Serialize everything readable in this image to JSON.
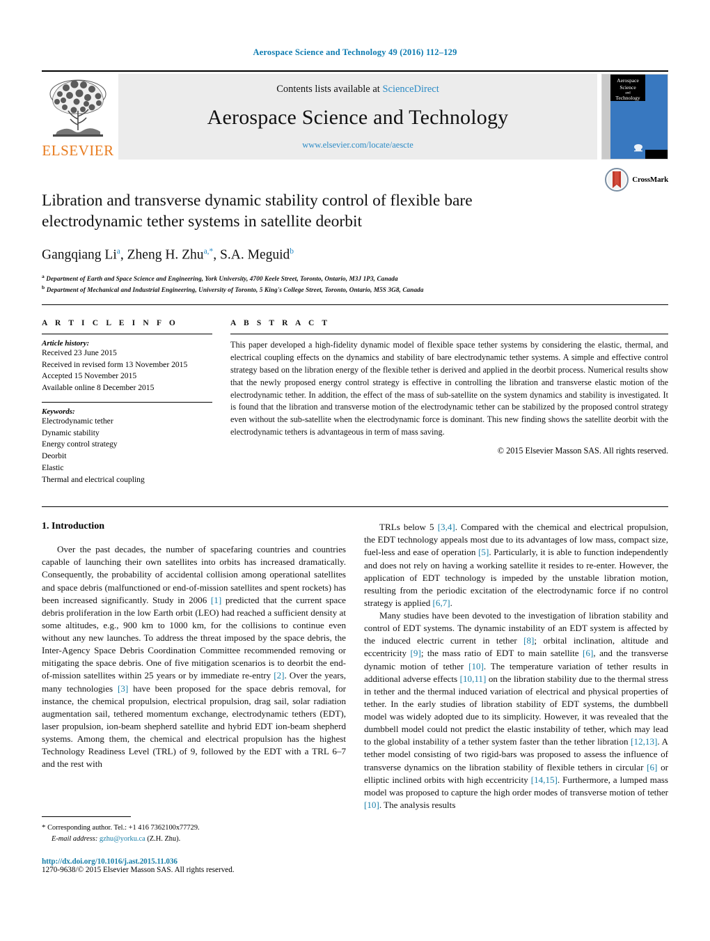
{
  "running_head": "Aerospace Science and Technology 49 (2016) 112–129",
  "masthead": {
    "publisher": "ELSEVIER",
    "contents_prefix": "Contents lists available at ",
    "contents_link": "ScienceDirect",
    "journal_title": "Aerospace Science and Technology",
    "journal_url": "www.elsevier.com/locate/aescte",
    "cover_title_lines": [
      "Aerospace",
      "Science",
      "and",
      "Technology"
    ]
  },
  "article": {
    "title": "Libration and transverse dynamic stability control of flexible bare electrodynamic tether systems in satellite deorbit",
    "crossmark_label": "CrossMark",
    "authors": [
      {
        "name": "Gangqiang Li",
        "sup": "a"
      },
      {
        "name": "Zheng H. Zhu",
        "sup": "a,*"
      },
      {
        "name": "S.A. Meguid",
        "sup": "b"
      }
    ],
    "affiliations": [
      {
        "marker": "a",
        "text": "Department of Earth and Space Science and Engineering, York University, 4700 Keele Street, Toronto, Ontario, M3J 1P3, Canada"
      },
      {
        "marker": "b",
        "text": "Department of Mechanical and Industrial Engineering, University of Toronto, 5 King's College Street, Toronto, Ontario, M5S 3G8, Canada"
      }
    ]
  },
  "article_info": {
    "heading": "A R T I C L E   I N F O",
    "history_label": "Article history:",
    "history": [
      "Received 23 June 2015",
      "Received in revised form 13 November 2015",
      "Accepted 15 November 2015",
      "Available online 8 December 2015"
    ],
    "keywords_label": "Keywords:",
    "keywords": [
      "Electrodynamic tether",
      "Dynamic stability",
      "Energy control strategy",
      "Deorbit",
      "Elastic",
      "Thermal and electrical coupling"
    ]
  },
  "abstract": {
    "heading": "A B S T R A C T",
    "text": "This paper developed a high-fidelity dynamic model of flexible space tether systems by considering the elastic, thermal, and electrical coupling effects on the dynamics and stability of bare electrodynamic tether systems. A simple and effective control strategy based on the libration energy of the flexible tether is derived and applied in the deorbit process. Numerical results show that the newly proposed energy control strategy is effective in controlling the libration and transverse elastic motion of the electrodynamic tether. In addition, the effect of the mass of sub-satellite on the system dynamics and stability is investigated. It is found that the libration and transverse motion of the electrodynamic tether can be stabilized by the proposed control strategy even without the sub-satellite when the electrodynamic force is dominant. This new finding shows the satellite deorbit with the electrodynamic tethers is advantageous in term of mass saving.",
    "copyright": "© 2015 Elsevier Masson SAS. All rights reserved."
  },
  "body": {
    "section_title": "1. Introduction",
    "left_paragraphs": [
      "Over the past decades, the number of spacefaring countries and countries capable of launching their own satellites into orbits has increased dramatically. Consequently, the probability of accidental collision among operational satellites and space debris (malfunctioned or end-of-mission satellites and spent rockets) has been increased significantly. Study in 2006 [1] predicted that the current space debris proliferation in the low Earth orbit (LEO) had reached a sufficient density at some altitudes, e.g., 900 km to 1000 km, for the collisions to continue even without any new launches. To address the threat imposed by the space debris, the Inter-Agency Space Debris Coordination Committee recommended removing or mitigating the space debris. One of five mitigation scenarios is to deorbit the end-of-mission satellites within 25 years or by immediate re-entry [2]. Over the years, many technologies [3] have been proposed for the space debris removal, for instance, the chemical propulsion, electrical propulsion, drag sail, solar radiation augmentation sail, tethered momentum exchange, electrodynamic tethers (EDT), laser propulsion, ion-beam shepherd satellite and hybrid EDT ion-beam shepherd systems. Among them, the chemical and electrical propulsion has the highest Technology Readiness Level (TRL) of 9, followed by the EDT with a TRL 6–7 and the rest with"
    ],
    "right_paragraphs": [
      "TRLs below 5 [3,4]. Compared with the chemical and electrical propulsion, the EDT technology appeals most due to its advantages of low mass, compact size, fuel-less and ease of operation [5]. Particularly, it is able to function independently and does not rely on having a working satellite it resides to re-enter. However, the application of EDT technology is impeded by the unstable libration motion, resulting from the periodic excitation of the electrodynamic force if no control strategy is applied [6,7].",
      "Many studies have been devoted to the investigation of libration stability and control of EDT systems. The dynamic instability of an EDT system is affected by the induced electric current in tether [8]; orbital inclination, altitude and eccentricity [9]; the mass ratio of EDT to main satellite [6], and the transverse dynamic motion of tether [10]. The temperature variation of tether results in additional adverse effects [10,11] on the libration stability due to the thermal stress in tether and the thermal induced variation of electrical and physical properties of tether. In the early studies of libration stability of EDT systems, the dumbbell model was widely adopted due to its simplicity. However, it was revealed that the dumbbell model could not predict the elastic instability of tether, which may lead to the global instability of a tether system faster than the tether libration [12,13]. A tether model consisting of two rigid-bars was proposed to assess the influence of transverse dynamics on the libration stability of flexible tethers in circular [6] or elliptic inclined orbits with high eccentricity [14,15]. Furthermore, a lumped mass model was proposed to capture the high order modes of transverse motion of tether [10]. The analysis results"
    ]
  },
  "footnote": {
    "star": "*",
    "corresponding": "Corresponding author. Tel.: +1 416 7362100x77729.",
    "email_label": "E-mail address:",
    "email": "gzhu@yorku.ca",
    "email_suffix": "(Z.H. Zhu).",
    "doi": "http://dx.doi.org/10.1016/j.ast.2015.11.036",
    "issn_line": "1270-9638/© 2015 Elsevier Masson SAS. All rights reserved."
  },
  "colors": {
    "link": "#1a7fa8",
    "running_head": "#0b7ab0",
    "elsevier_orange": "#E87B1E",
    "cover_blue": "#3878c0",
    "masthead_bg": "#ececec"
  }
}
